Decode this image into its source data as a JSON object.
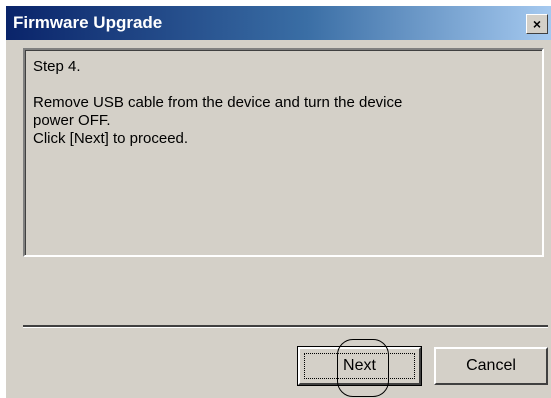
{
  "window": {
    "title": "Firmware Upgrade",
    "close_label": "×"
  },
  "message": {
    "step": "Step 4.",
    "line1": "Remove USB cable from the device and turn the device",
    "line2": "power OFF.",
    "line3": "Click [Next] to proceed."
  },
  "buttons": {
    "next_label": "Next",
    "cancel_label": "Cancel"
  },
  "colors": {
    "titlebar_start": "#0a246a",
    "titlebar_end": "#a6caf0",
    "face": "#d4d0c8"
  }
}
